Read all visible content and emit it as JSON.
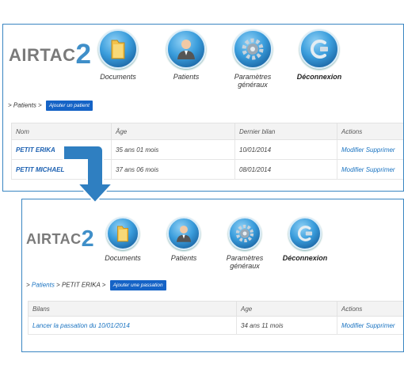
{
  "top": {
    "logo": {
      "text": "AIRTAC",
      "digit": "2"
    },
    "nav": [
      {
        "label": "Documents",
        "icon": "folder-icon"
      },
      {
        "label": "Patients",
        "icon": "user-icon"
      },
      {
        "label": "Paramètres généraux",
        "label_line1": "Paramètres",
        "label_line2": "généraux",
        "icon": "gear-icon"
      },
      {
        "label": "Déconnexion",
        "icon": "power-icon"
      }
    ],
    "breadcrumb": {
      "sep": ">",
      "item": "Patients"
    },
    "add_button": "Ajouter un patient",
    "table": {
      "headers": [
        "Nom",
        "Âge",
        "Dernier bilan",
        "Actions"
      ],
      "rows": [
        {
          "name": "PETIT ERIKA",
          "age": "35 ans 01 mois",
          "last": "10/01/2014",
          "edit": "Modifier",
          "delete": "Supprimer"
        },
        {
          "name": "PETIT MICHAEL",
          "age": "37 ans 06 mois",
          "last": "08/01/2014",
          "edit": "Modifier",
          "delete": "Supprimer"
        }
      ]
    }
  },
  "bottom": {
    "logo": {
      "text": "AIRTAC",
      "digit": "2"
    },
    "nav": [
      {
        "label": "Documents",
        "icon": "folder-icon"
      },
      {
        "label": "Patients",
        "icon": "user-icon"
      },
      {
        "label": "Paramètres généraux",
        "label_line1": "Paramètres",
        "label_line2": "généraux",
        "icon": "gear-icon"
      },
      {
        "label": "Déconnexion",
        "icon": "power-icon"
      }
    ],
    "breadcrumb": {
      "sep": ">",
      "item1": "Patients",
      "item2": "PETIT ERIKA"
    },
    "add_button": "Ajouter une passation",
    "table": {
      "headers": [
        "Bilans",
        "Age",
        "Actions"
      ],
      "rows": [
        {
          "bilan": "Lancer la passation du 10/01/2014",
          "age": "34 ans 11 mois",
          "edit": "Modifier",
          "delete": "Supprimer"
        }
      ]
    }
  },
  "colors": {
    "accent": "#1563c6",
    "link": "#1a73c1",
    "frame": "#3a86c2",
    "arrow": "#2f7fc1"
  }
}
